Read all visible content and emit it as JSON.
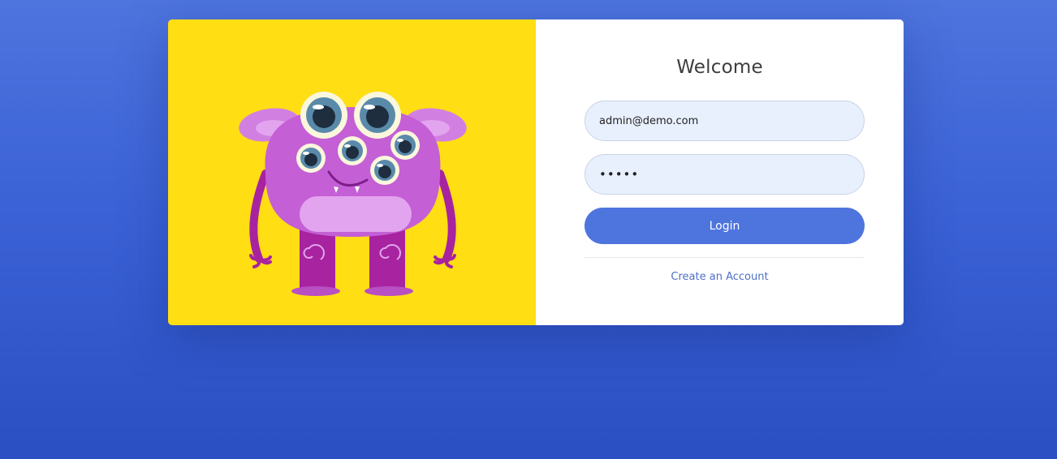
{
  "login": {
    "title": "Welcome",
    "email_value": "admin@demo.com",
    "password_value": "12345",
    "login_label": "Login",
    "create_account_label": "Create an Account"
  },
  "illustration": {
    "subject": "purple-monster",
    "background_color": "#ffde14",
    "body_color": "#c45fd6"
  },
  "colors": {
    "background_top": "#4e74de",
    "background_bottom": "#2a4fc3",
    "accent": "#4e74de",
    "link": "#4e6fc4",
    "input_fill": "#e8f0fe"
  }
}
